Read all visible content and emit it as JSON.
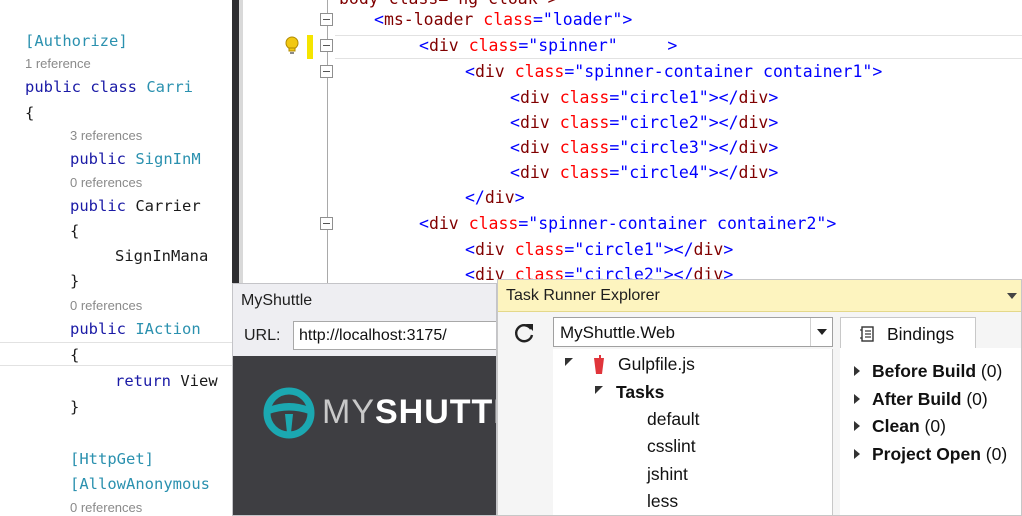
{
  "left_editor": {
    "lines": [
      {
        "text": "[Authorize]"
      },
      {
        "ref": "1 reference"
      },
      {
        "kw": "public class ",
        "rest": "Carri"
      },
      {
        "text": "{"
      },
      {
        "ref": "3 references"
      },
      {
        "kw": "public ",
        "type": "SignInM"
      },
      {
        "ref": "0 references"
      },
      {
        "kw": "public ",
        "rest": "Carrier"
      },
      {
        "text": "{"
      },
      {
        "text": "SignInMana"
      },
      {
        "text": "}"
      },
      {
        "ref": "0 references"
      },
      {
        "kw": "public ",
        "type": "IAction"
      },
      {
        "text": "{"
      },
      {
        "kw": "return ",
        "rest": "View"
      },
      {
        "text": "}"
      },
      {
        "text": "[HttpGet]"
      },
      {
        "text": "[AllowAnonymous"
      },
      {
        "ref": "0 references"
      }
    ]
  },
  "html_editor": {
    "top_partial": "body class=\"ng-cloak\">",
    "line1": {
      "tag": "ms-loader",
      "attr": "class",
      "value": "\"loader\""
    },
    "line2": {
      "tag": "div",
      "attr": "class",
      "value": "\"spinner\"",
      "tail": ">"
    },
    "line3": {
      "tag": "div",
      "attr": "class",
      "value": "\"spinner-container container1\""
    },
    "circles1": [
      {
        "value": "\"circle1\""
      },
      {
        "value": "\"circle2\""
      },
      {
        "value": "\"circle3\""
      },
      {
        "value": "\"circle4\""
      }
    ],
    "close_div": "div",
    "line9": {
      "tag": "div",
      "attr": "class",
      "value": "\"spinner-container container2\""
    },
    "line10": {
      "value": "\"circle1\""
    },
    "line11": {
      "value": "\"circle2\""
    }
  },
  "browser": {
    "title": "MyShuttle",
    "url_label": "URL:",
    "url_value": "http://localhost:3175/",
    "logo_my": "MY",
    "logo_shuttle": "SHUTTLE"
  },
  "task_runner": {
    "title": "Task Runner Explorer",
    "project": "MyShuttle.Web",
    "tree": {
      "file": "Gulpfile.js",
      "tasks_label": "Tasks",
      "tasks": [
        "default",
        "csslint",
        "jshint",
        "less"
      ]
    },
    "bindings_tab": "Bindings",
    "bindings": [
      {
        "name": "Before Build",
        "count": "(0)"
      },
      {
        "name": "After Build",
        "count": "(0)"
      },
      {
        "name": "Clean",
        "count": "(0)"
      },
      {
        "name": "Project Open",
        "count": "(0)"
      }
    ]
  },
  "colors": {
    "keyword": "#1a1aa6",
    "type": "#2b91af",
    "tag": "#800000",
    "attribute": "#ff0000",
    "value": "#0000ff",
    "task_runner_titlebar": "#fdf4bf",
    "site_background": "#3e3e42",
    "logo_accent": "#1ba8b1"
  }
}
